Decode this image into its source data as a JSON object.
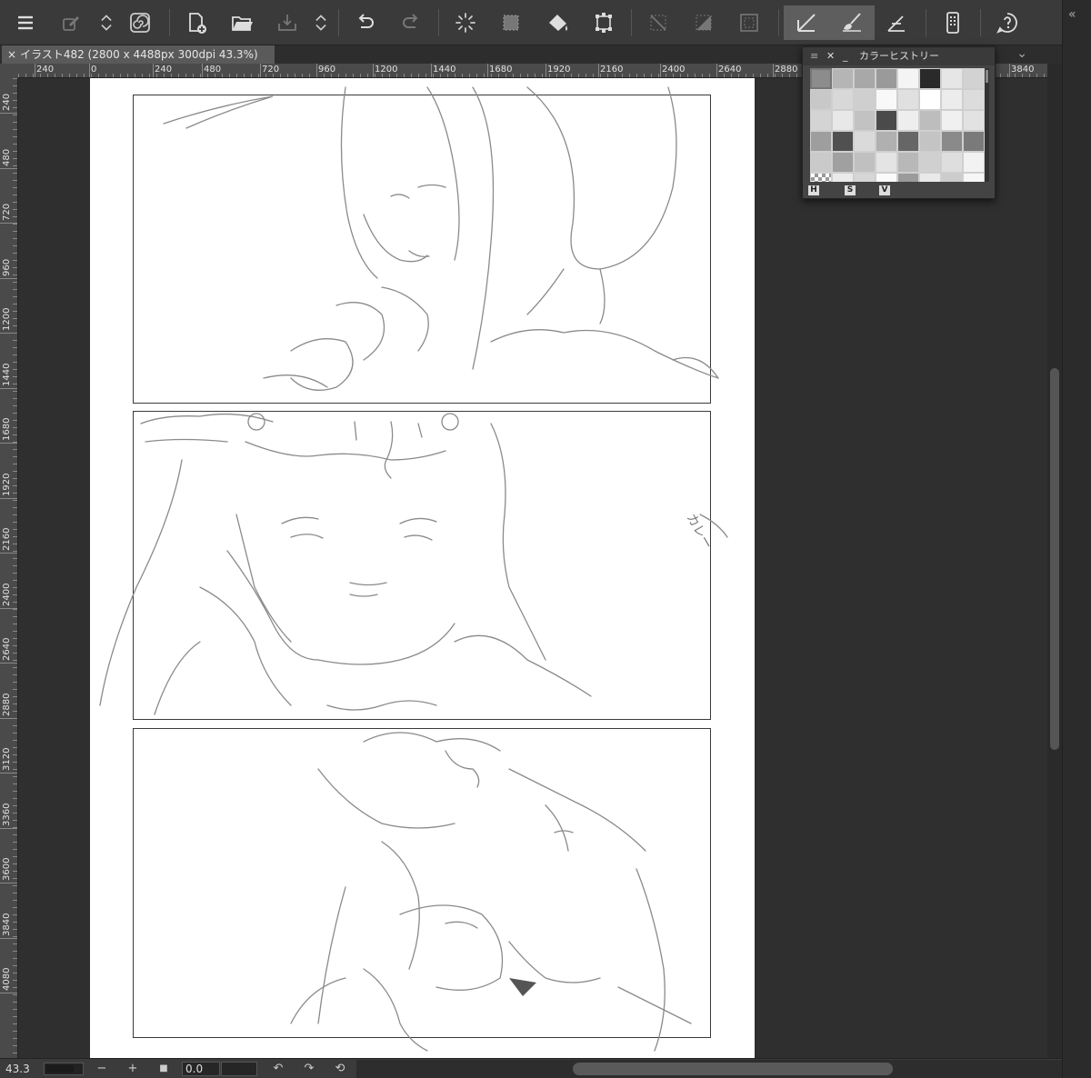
{
  "toolbar": {
    "buttons": [
      {
        "name": "menu-button",
        "icon": "hamburger-icon"
      },
      {
        "name": "brush-settings-button",
        "icon": "eyedropper-icon"
      },
      {
        "name": "swap-button",
        "icon": "updown-icon"
      },
      {
        "name": "spiral-button",
        "icon": "spiral-icon"
      },
      {
        "name": "new-file-button",
        "icon": "new-file-icon"
      },
      {
        "name": "open-button",
        "icon": "folder-icon"
      },
      {
        "name": "save-button",
        "icon": "save-icon"
      },
      {
        "name": "undo-button",
        "icon": "undo-icon"
      },
      {
        "name": "redo-button",
        "icon": "redo-icon"
      },
      {
        "name": "loading-button",
        "icon": "spinner-icon"
      },
      {
        "name": "select-button",
        "icon": "selection-icon"
      },
      {
        "name": "fill-button",
        "icon": "bucket-icon"
      },
      {
        "name": "transform-button",
        "icon": "transform-icon"
      },
      {
        "name": "deselect-button",
        "icon": "deselect-icon"
      },
      {
        "name": "invert-button",
        "icon": "invert-icon"
      },
      {
        "name": "border-button",
        "icon": "border-icon"
      },
      {
        "name": "ruler-button",
        "icon": "ruler-icon"
      },
      {
        "name": "paint-button",
        "icon": "brush-icon"
      },
      {
        "name": "perspective-button",
        "icon": "perspective-icon"
      },
      {
        "name": "device-button",
        "icon": "device-icon"
      },
      {
        "name": "help-button",
        "icon": "help-icon"
      }
    ]
  },
  "document_tab": {
    "close": "×",
    "title": "イラスト482 (2800 x 4488px 300dpi 43.3%)"
  },
  "ruler_h": {
    "labels": [
      "240",
      "0",
      "240",
      "480",
      "720",
      "960",
      "1200",
      "1440",
      "1680",
      "1920",
      "2160",
      "2400",
      "2640",
      "2880",
      "3840"
    ]
  },
  "ruler_v": {
    "labels": [
      "240",
      "480",
      "720",
      "960",
      "1200",
      "1440",
      "1680",
      "1920",
      "2160",
      "2400",
      "2640",
      "2880",
      "3120",
      "3360",
      "3600",
      "3840",
      "4080"
    ]
  },
  "color_history": {
    "title": "カラーヒストリー",
    "swatches": [
      "#8c8c8c",
      "#b5b5b5",
      "#a8a8a8",
      "#9a9a9a",
      "#f4f4f4",
      "#2a2a2a",
      "#e6e6e6",
      "#d2d2d2",
      "#c8c8c8",
      "#d8d8d8",
      "#cfcfcf",
      "#f8f8f8",
      "#e0e0e0",
      "#ffffff",
      "#ececec",
      "#dcdcdc",
      "#d4d4d4",
      "#e8e8e8",
      "#c2c2c2",
      "#4a4a4a",
      "#eeeeee",
      "#bdbdbd",
      "#f0f0f0",
      "#e2e2e2",
      "#9e9e9e",
      "#505050",
      "#dadada",
      "#b0b0b0",
      "#666666",
      "#c4c4c4",
      "#8a8a8a",
      "#7a7a7a",
      "#cacaca",
      "#a0a0a0",
      "#c0c0c0",
      "#e4e4e4",
      "#b8b8b8",
      "#d0d0d0",
      "#dedede",
      "#f2f2f2",
      "#bbbbbb",
      "#eaeaea",
      "#d6d6d6",
      "#fafafa",
      "#9b9b9b",
      "#e9e9e9",
      "#cccccc",
      "#f6f6f6"
    ],
    "hsv_labels": [
      "H",
      "S",
      "V"
    ]
  },
  "bottom_bar": {
    "zoom": "43.3",
    "zoom_out": "−",
    "zoom_in": "+",
    "fit": "■",
    "angle": "0.0",
    "rotate_left": "↶",
    "rotate_right": "↷",
    "reset": "⟲"
  },
  "right_dock": {
    "collapse": "«"
  },
  "tab_bar": {
    "panel_toggle": "⌄"
  },
  "canvas": {
    "note_text": "カレー"
  }
}
